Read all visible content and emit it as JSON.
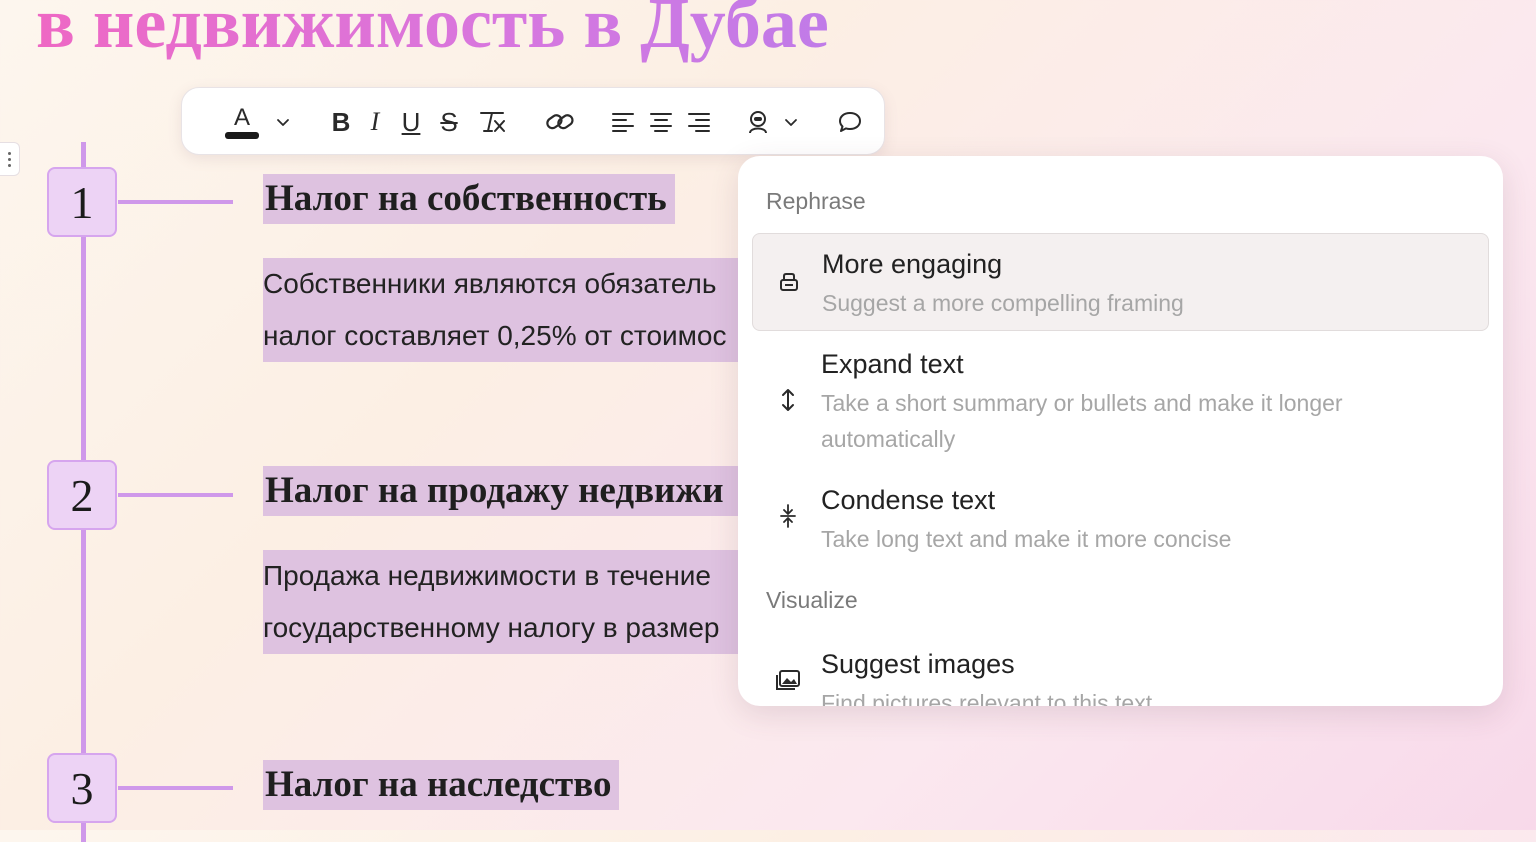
{
  "document": {
    "title": "в недвижимость в Дубае",
    "steps": [
      {
        "number": "1",
        "heading": "Налог на собственность",
        "paragraph": [
          "Собственники являются обязатель",
          "налог составляет 0,25% от стоимос"
        ]
      },
      {
        "number": "2",
        "heading": "Налог на продажу недвижи",
        "paragraph": [
          "Продажа недвижимости в течение",
          "государственному налогу в размер"
        ]
      },
      {
        "number": "3",
        "heading": "Налог на наследство",
        "paragraph": []
      }
    ]
  },
  "toolbar": {
    "text_color_letter": "A",
    "bold": "B",
    "italic": "I",
    "underline": "U",
    "strikethrough": "S",
    "icons": [
      "text-color-icon",
      "chevron-down-icon",
      "bold-icon",
      "italic-icon",
      "underline-icon",
      "strikethrough-icon",
      "clear-format-icon",
      "link-icon",
      "align-left-icon",
      "align-center-icon",
      "align-right-icon",
      "ai-assistant-icon",
      "chevron-down-icon",
      "comment-icon"
    ]
  },
  "dropdown": {
    "sections": [
      {
        "label": "Rephrase",
        "items": [
          {
            "title": "More engaging",
            "description": "Suggest a more compelling framing",
            "icon": "engaging-icon",
            "active": true
          },
          {
            "title": "Expand text",
            "description": "Take a short summary or bullets and make it longer automatically",
            "icon": "expand-vertical-icon",
            "active": false
          },
          {
            "title": "Condense text",
            "description": "Take long text and make it more concise",
            "icon": "condense-vertical-icon",
            "active": false
          }
        ]
      },
      {
        "label": "Visualize",
        "items": [
          {
            "title": "Suggest images",
            "description": "Find pictures relevant to this text",
            "icon": "image-icon",
            "active": false
          }
        ]
      }
    ]
  },
  "colors": {
    "title_gradient_start": "#ee68c4",
    "title_gradient_end": "#c07be8",
    "timeline": "#cf98ea",
    "step_box_fill": "#edd3f5",
    "highlight": "#dec2e0"
  }
}
